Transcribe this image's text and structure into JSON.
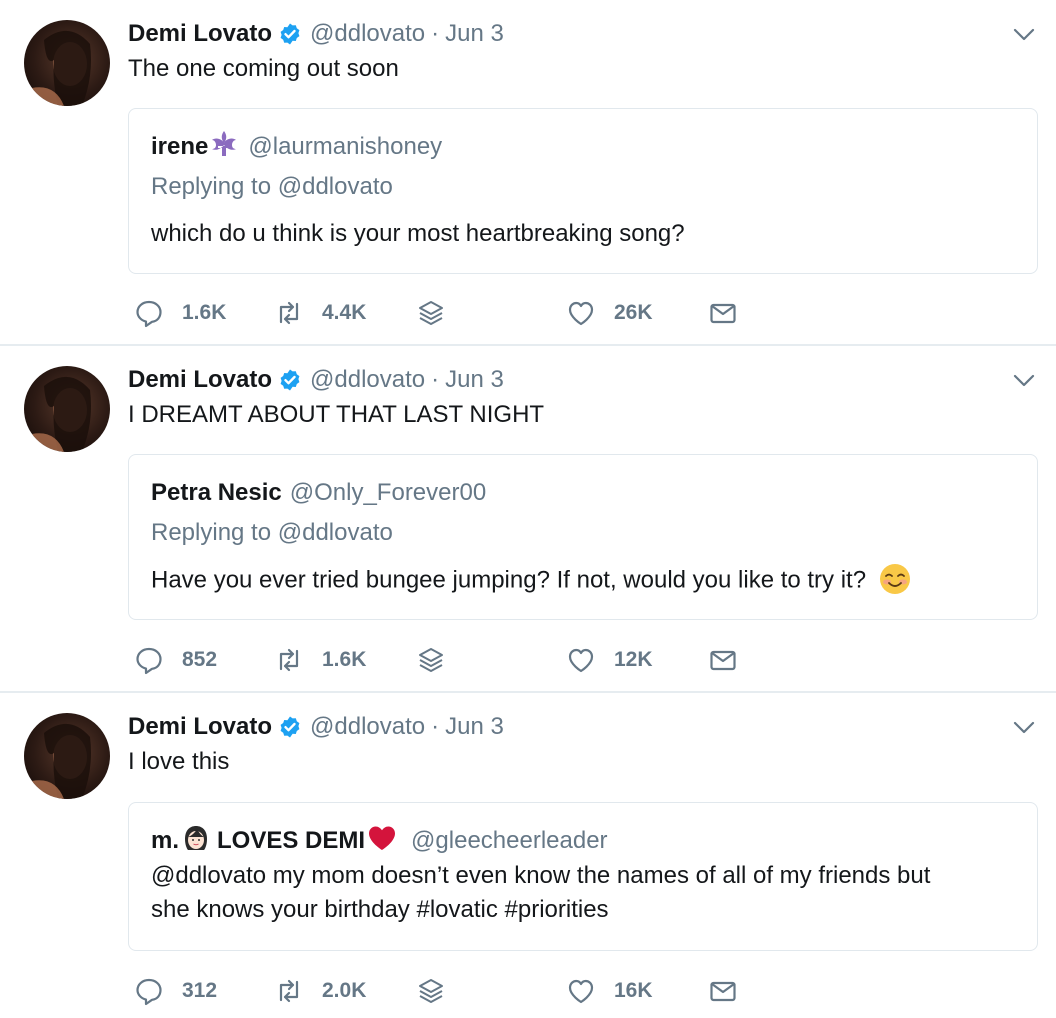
{
  "colors": {
    "text": "#14171a",
    "muted": "#657786",
    "verified": "#1da1f2",
    "border": "#e1e8ed",
    "heart": "#d4143c"
  },
  "tweets": [
    {
      "author": {
        "name": "Demi Lovato",
        "handle": "@ddlovato",
        "verified": true
      },
      "separator": "·",
      "date": "Jun 3",
      "text": "The one coming out soon",
      "quote": {
        "name": "irene",
        "name_emoji": "fleur-de-lis-icon",
        "handle": "@laurmanishoney",
        "replying_prefix": "Replying to",
        "replying_to": "@ddlovato",
        "lines": [
          "which do u think is your most heartbreaking song?"
        ]
      },
      "stats": {
        "replies": "1.6K",
        "retweets": "4.4K",
        "likes": "26K"
      }
    },
    {
      "author": {
        "name": "Demi Lovato",
        "handle": "@ddlovato",
        "verified": true
      },
      "separator": "·",
      "date": "Jun 3",
      "text": "I DREAMT ABOUT THAT LAST NIGHT",
      "quote": {
        "name": "Petra Nesic",
        "handle": "@Only_Forever00",
        "replying_prefix": "Replying to",
        "replying_to": "@ddlovato",
        "lines": [
          "Have you ever tried bungee jumping? If not, would you like to try it?"
        ],
        "trailing_emoji": "smiling-face-icon"
      },
      "stats": {
        "replies": "852",
        "retweets": "1.6K",
        "likes": "12K"
      }
    },
    {
      "author": {
        "name": "Demi Lovato",
        "handle": "@ddlovato",
        "verified": true
      },
      "separator": "·",
      "date": "Jun 3",
      "text": "I love this",
      "quote": {
        "name_prefix": "m.",
        "name_emoji": "woman-face-icon",
        "name_suffix": "LOVES DEMI",
        "name_trailing_emoji": "red-heart-icon",
        "handle": "@gleecheerleader",
        "lines": [
          "@ddlovato my mom doesn’t even know the names of all of my friends but",
          "she knows your birthday #lovatic #priorities"
        ]
      },
      "stats": {
        "replies": "312",
        "retweets": "2.0K",
        "likes": "16K"
      }
    }
  ]
}
